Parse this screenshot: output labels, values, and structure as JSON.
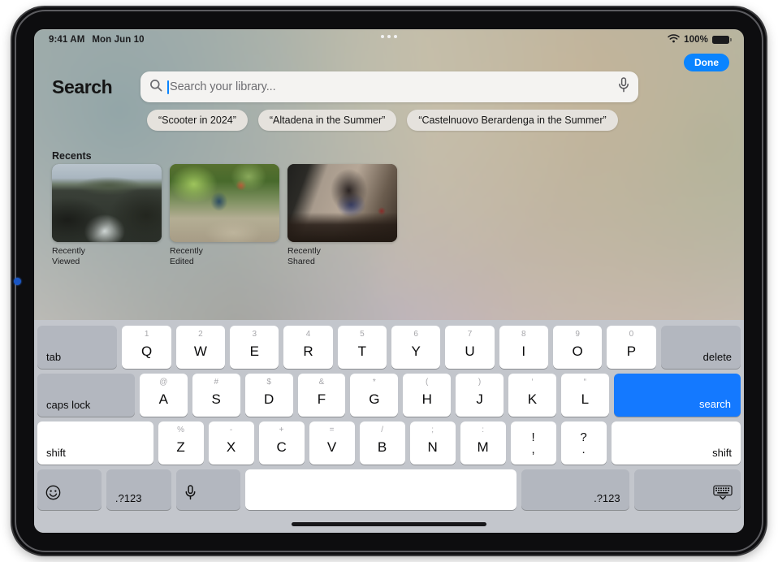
{
  "status_bar": {
    "time": "9:41 AM",
    "date": "Mon Jun 10",
    "battery_percent": "100%",
    "wifi_icon": "wifi-icon",
    "battery_icon": "battery-icon",
    "multitask_handle": "multitasking-handle"
  },
  "header": {
    "done_label": "Done",
    "title": "Search"
  },
  "search": {
    "placeholder": "Search your library...",
    "value": "",
    "search_icon": "search-icon",
    "mic_icon": "microphone-icon"
  },
  "suggestions": [
    {
      "label": "“Scooter in 2024”"
    },
    {
      "label": "“Altadena in the Summer”"
    },
    {
      "label": "“Castelnuovo Berardenga in the Summer”"
    }
  ],
  "recents": {
    "section_title": "Recents",
    "items": [
      {
        "caption": "Recently Viewed"
      },
      {
        "caption": "Recently Edited"
      },
      {
        "caption": "Recently Shared"
      }
    ]
  },
  "keyboard": {
    "row1": [
      {
        "label": "tab",
        "type": "mod"
      },
      {
        "sup": "1",
        "main": "Q"
      },
      {
        "sup": "2",
        "main": "W"
      },
      {
        "sup": "3",
        "main": "E"
      },
      {
        "sup": "4",
        "main": "R"
      },
      {
        "sup": "5",
        "main": "T"
      },
      {
        "sup": "6",
        "main": "Y"
      },
      {
        "sup": "7",
        "main": "U"
      },
      {
        "sup": "8",
        "main": "I"
      },
      {
        "sup": "9",
        "main": "O"
      },
      {
        "sup": "0",
        "main": "P"
      },
      {
        "label": "delete",
        "type": "mod"
      }
    ],
    "row2": [
      {
        "label": "caps lock",
        "type": "mod"
      },
      {
        "sup": "@",
        "main": "A"
      },
      {
        "sup": "#",
        "main": "S"
      },
      {
        "sup": "$",
        "main": "D"
      },
      {
        "sup": "&",
        "main": "F"
      },
      {
        "sup": "*",
        "main": "G"
      },
      {
        "sup": "(",
        "main": "H"
      },
      {
        "sup": ")",
        "main": "J"
      },
      {
        "sup": "‘",
        "main": "K"
      },
      {
        "sup": "“",
        "main": "L"
      },
      {
        "label": "search",
        "type": "go"
      }
    ],
    "row3": [
      {
        "label": "shift",
        "type": "mod-light"
      },
      {
        "sup": "%",
        "main": "Z"
      },
      {
        "sup": "-",
        "main": "X"
      },
      {
        "sup": "+",
        "main": "C"
      },
      {
        "sup": "=",
        "main": "V"
      },
      {
        "sup": "/",
        "main": "B"
      },
      {
        "sup": ";",
        "main": "N"
      },
      {
        "sup": ":",
        "main": "M"
      },
      {
        "top": "!",
        "bot": ",",
        "type": "punct"
      },
      {
        "top": "?",
        "bot": ".",
        "type": "punct"
      },
      {
        "label": "shift",
        "type": "mod-light"
      }
    ],
    "row4": [
      {
        "icon": "emoji-smiley-icon",
        "type": "mod"
      },
      {
        "label": ".?123",
        "type": "mod"
      },
      {
        "icon": "microphone-icon",
        "type": "mod"
      },
      {
        "label": "",
        "type": "space"
      },
      {
        "label": ".?123",
        "type": "mod"
      },
      {
        "icon": "dismiss-keyboard-icon",
        "type": "mod"
      }
    ]
  },
  "colors": {
    "accent_blue": "#0a84ff",
    "return_key_blue": "#1479ff",
    "keyboard_background": "#c3c6cc",
    "key_white": "#ffffff",
    "key_gray": "#b3b7bf"
  }
}
